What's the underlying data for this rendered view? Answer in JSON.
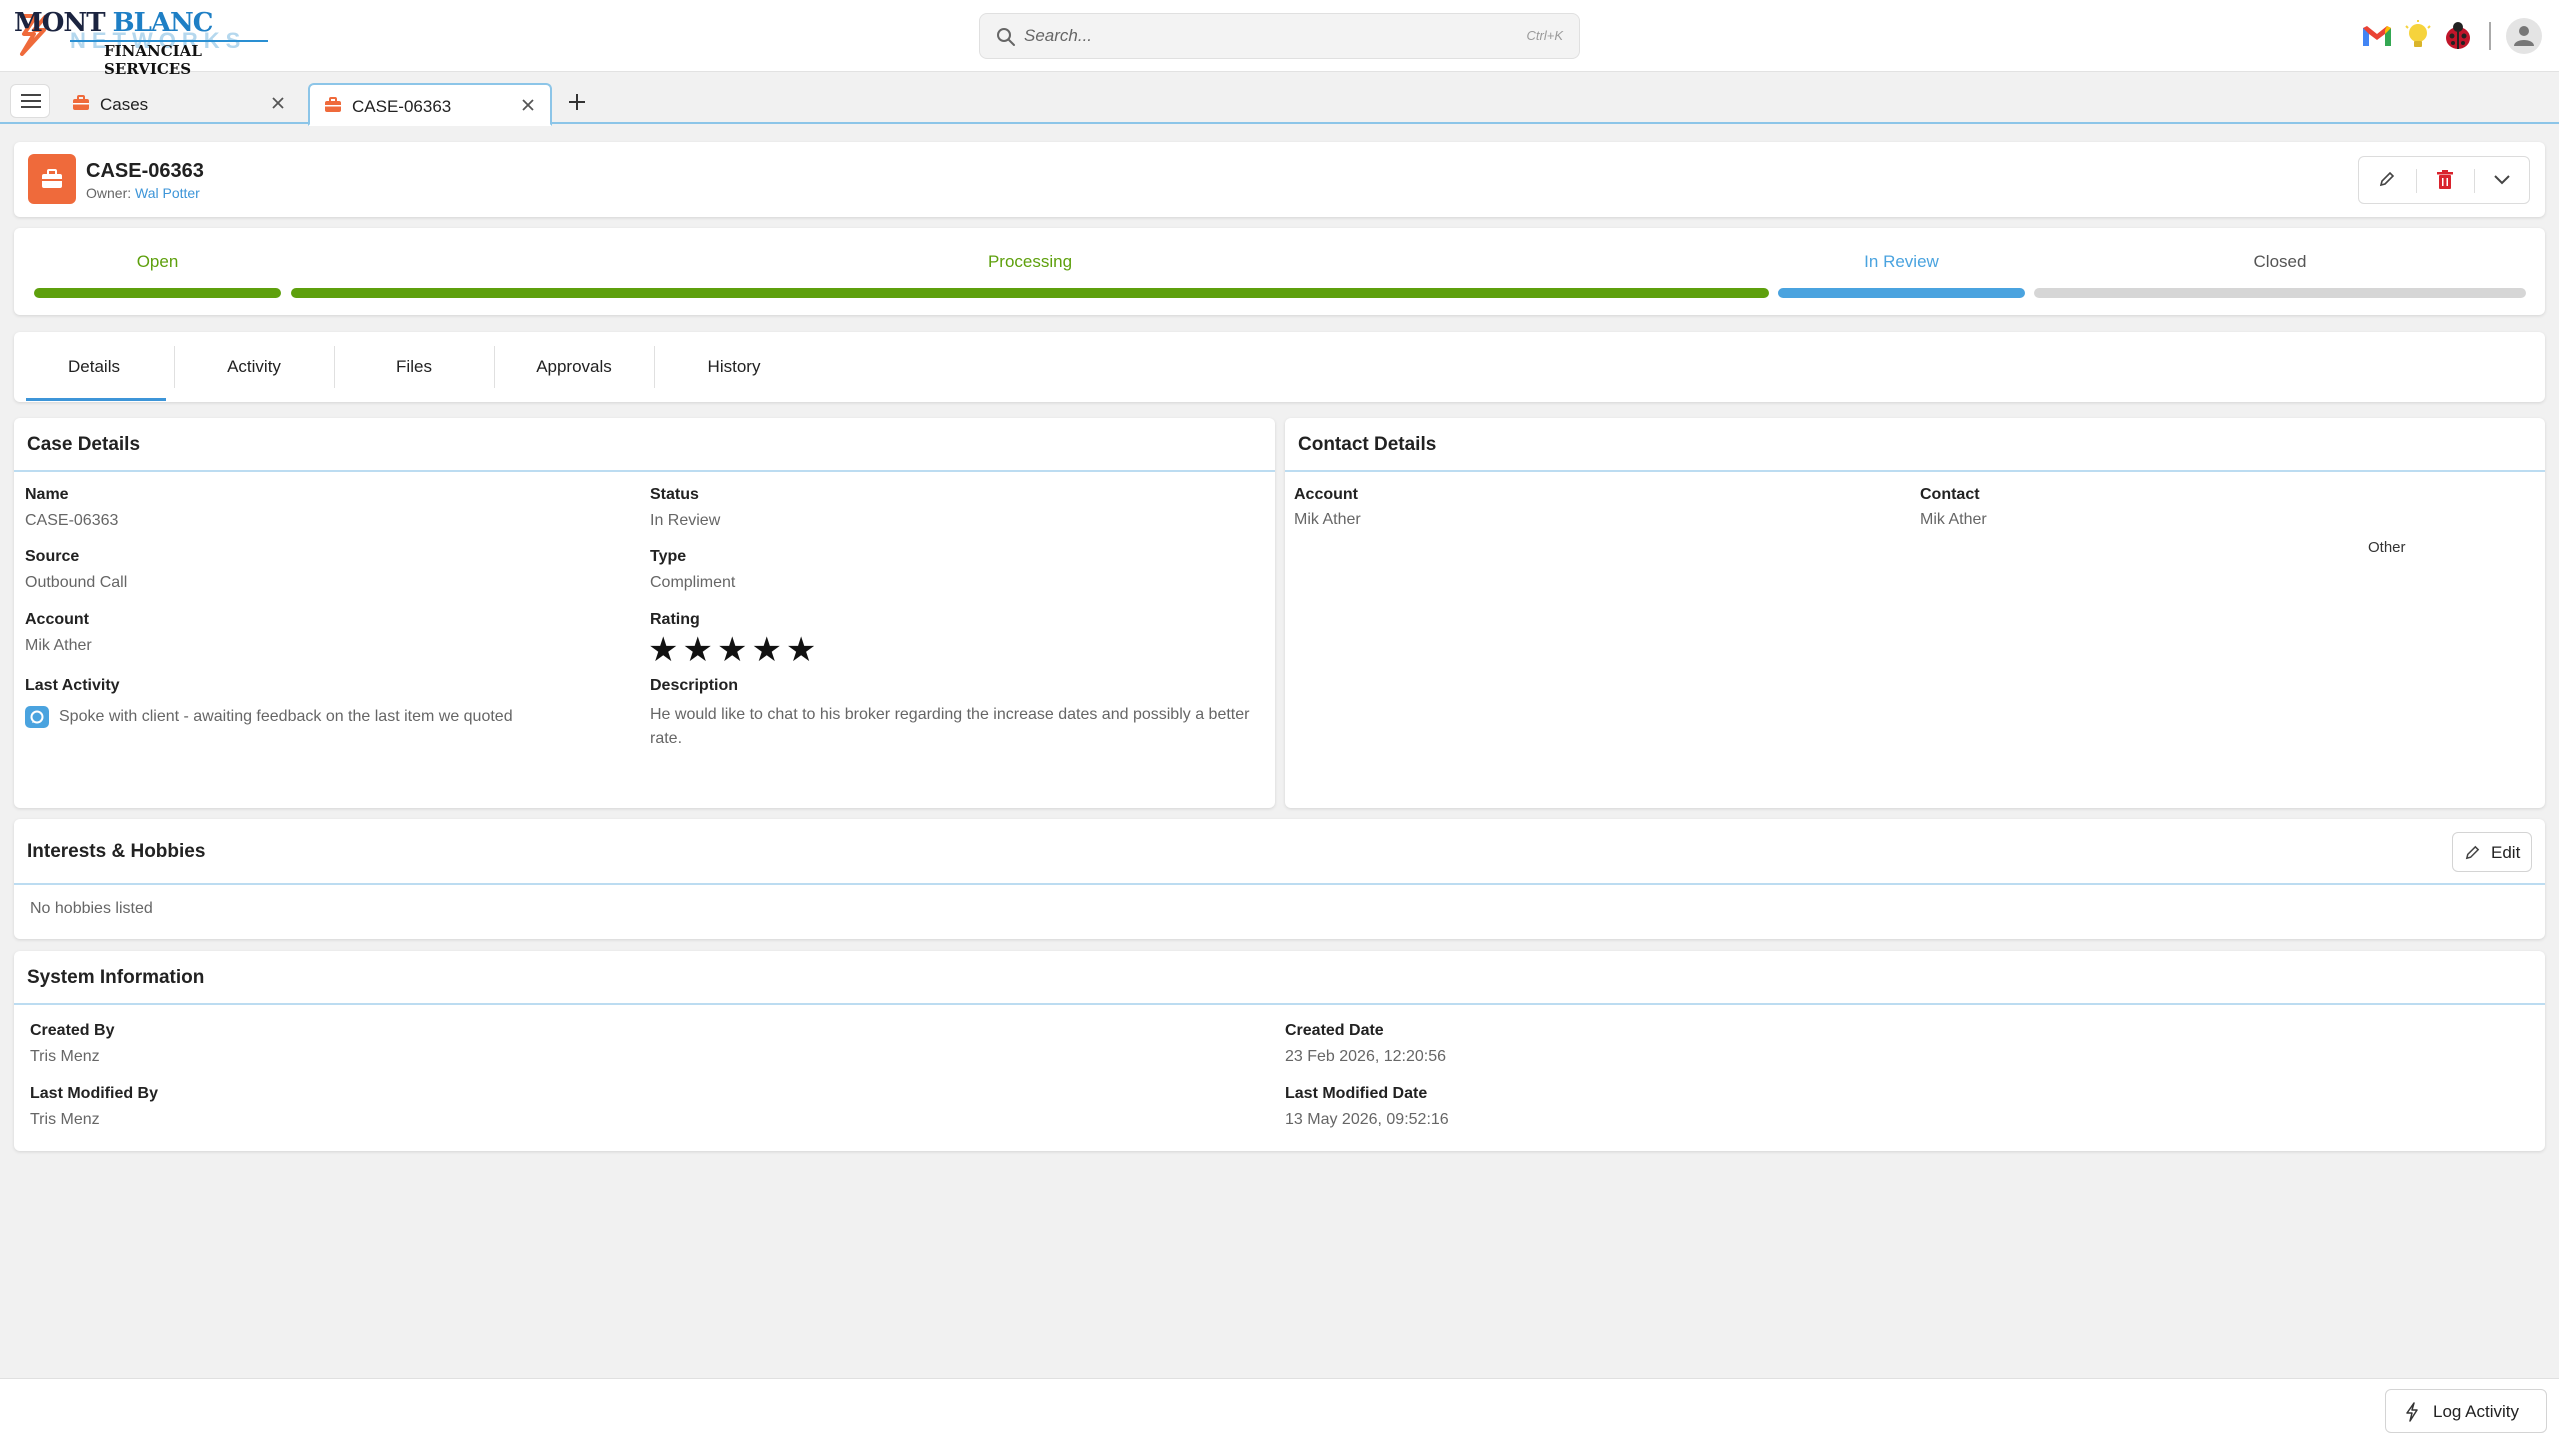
{
  "brand": {
    "name_part1": "MONT",
    "name_part2": "BLANC",
    "subtitle": "FINANCIAL SERVICES"
  },
  "search": {
    "placeholder": "Search...",
    "shortcut": "Ctrl+K"
  },
  "topbar_icons": [
    "gmail-icon",
    "lightbulb-icon",
    "ladybug-icon",
    "user-avatar-icon"
  ],
  "tabs": [
    {
      "label": "Cases",
      "icon": "briefcase-icon",
      "active": false
    },
    {
      "label": "CASE-06363",
      "icon": "briefcase-icon",
      "active": true
    }
  ],
  "record": {
    "title": "CASE-06363",
    "owner_label": "Owner:",
    "owner_name": "Wal Potter"
  },
  "path": {
    "stages": [
      {
        "label": "Open",
        "state": "complete"
      },
      {
        "label": "Processing",
        "state": "complete"
      },
      {
        "label": "In Review",
        "state": "current"
      },
      {
        "label": "Closed",
        "state": "pending"
      }
    ],
    "colors": {
      "complete": "#5ea00d",
      "current": "#4aa3df",
      "pending": "#d6d6d6",
      "closed_text": "#555555"
    }
  },
  "subtabs": [
    "Details",
    "Activity",
    "Files",
    "Approvals",
    "History"
  ],
  "case_details": {
    "title": "Case Details",
    "name_label": "Name",
    "name_value": "CASE-06363",
    "source_label": "Source",
    "source_value": "Outbound Call",
    "account_label": "Account",
    "account_value": "Mik Ather",
    "last_activity_label": "Last Activity",
    "last_activity_value": "Spoke with client - awaiting feedback on the last item we quoted",
    "status_label": "Status",
    "status_value": "In Review",
    "type_label": "Type",
    "type_value": "Compliment",
    "rating_label": "Rating",
    "rating_value": 5,
    "rating_max": 5,
    "rating_stars": "★★★★★",
    "description_label": "Description",
    "description_value": "He would like to chat to his broker regarding the increase dates and possibly a better rate."
  },
  "contact_details": {
    "title": "Contact Details",
    "account_label": "Account",
    "account_value": "Mik Ather",
    "contact_label": "Contact",
    "contact_value": "Mik Ather",
    "other_text": "Other"
  },
  "hobbies": {
    "title": "Interests & Hobbies",
    "edit_label": "Edit",
    "empty_text": "No hobbies listed"
  },
  "system_info": {
    "title": "System Information",
    "created_by_label": "Created By",
    "created_by_value": "Tris Menz",
    "last_modified_by_label": "Last Modified By",
    "last_modified_by_value": "Tris Menz",
    "created_date_label": "Created Date",
    "created_date_value": "23 Feb 2026, 12:20:56",
    "last_modified_date_label": "Last Modified Date",
    "last_modified_date_value": "13 May 2026, 09:52:16"
  },
  "footer": {
    "log_activity_label": "Log Activity"
  },
  "colors": {
    "accent_blue": "#3d95d8",
    "brand_orange": "#ef6a3b",
    "delete_red": "#d9232d"
  }
}
